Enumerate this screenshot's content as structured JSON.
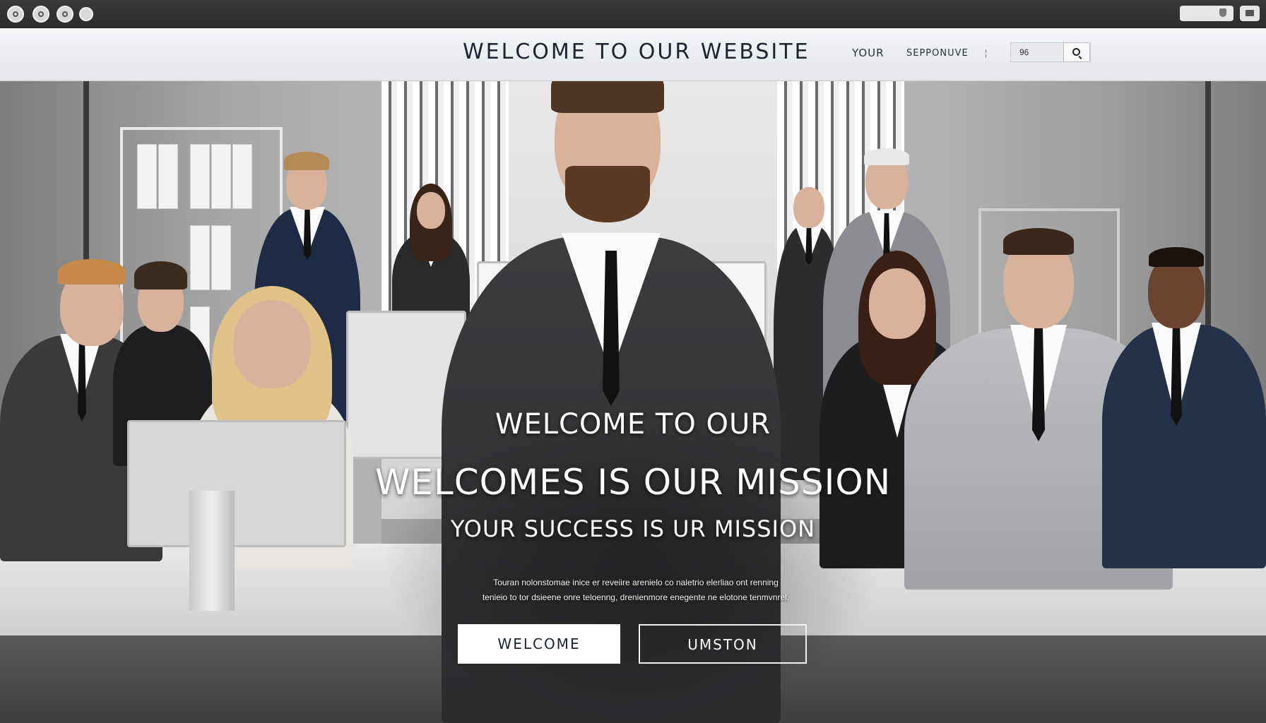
{
  "browser": {
    "window_controls": [
      "close",
      "minimize",
      "maximize",
      "fullscreen"
    ]
  },
  "header": {
    "brand": "WELCOME TO OUR WEBSITE",
    "nav": [
      "YOUR",
      "SEPPONUVE"
    ],
    "separator": "¦",
    "search": {
      "value": "96",
      "button_icon": "search-icon"
    }
  },
  "hero": {
    "line1": "WELCOME TO OUR",
    "line2": "WELCOMES IS OUR MISSION",
    "line3": "YOUR SUCCESS IS UR MISSION",
    "body_line1": "Touran nolonstomae inice er reveiire arenielo co naletrio elerliao ont renning",
    "body_line2": "tenieio to tor dsieene onre teloenng, drenienmore enegente ne elotone tenmvnrel.",
    "buttons": {
      "primary": "WELCOME",
      "secondary": "UMSTON"
    }
  },
  "colors": {
    "header_bg": "#eceef1",
    "text_dark": "#1d2430",
    "chrome": "#2f2f31"
  }
}
